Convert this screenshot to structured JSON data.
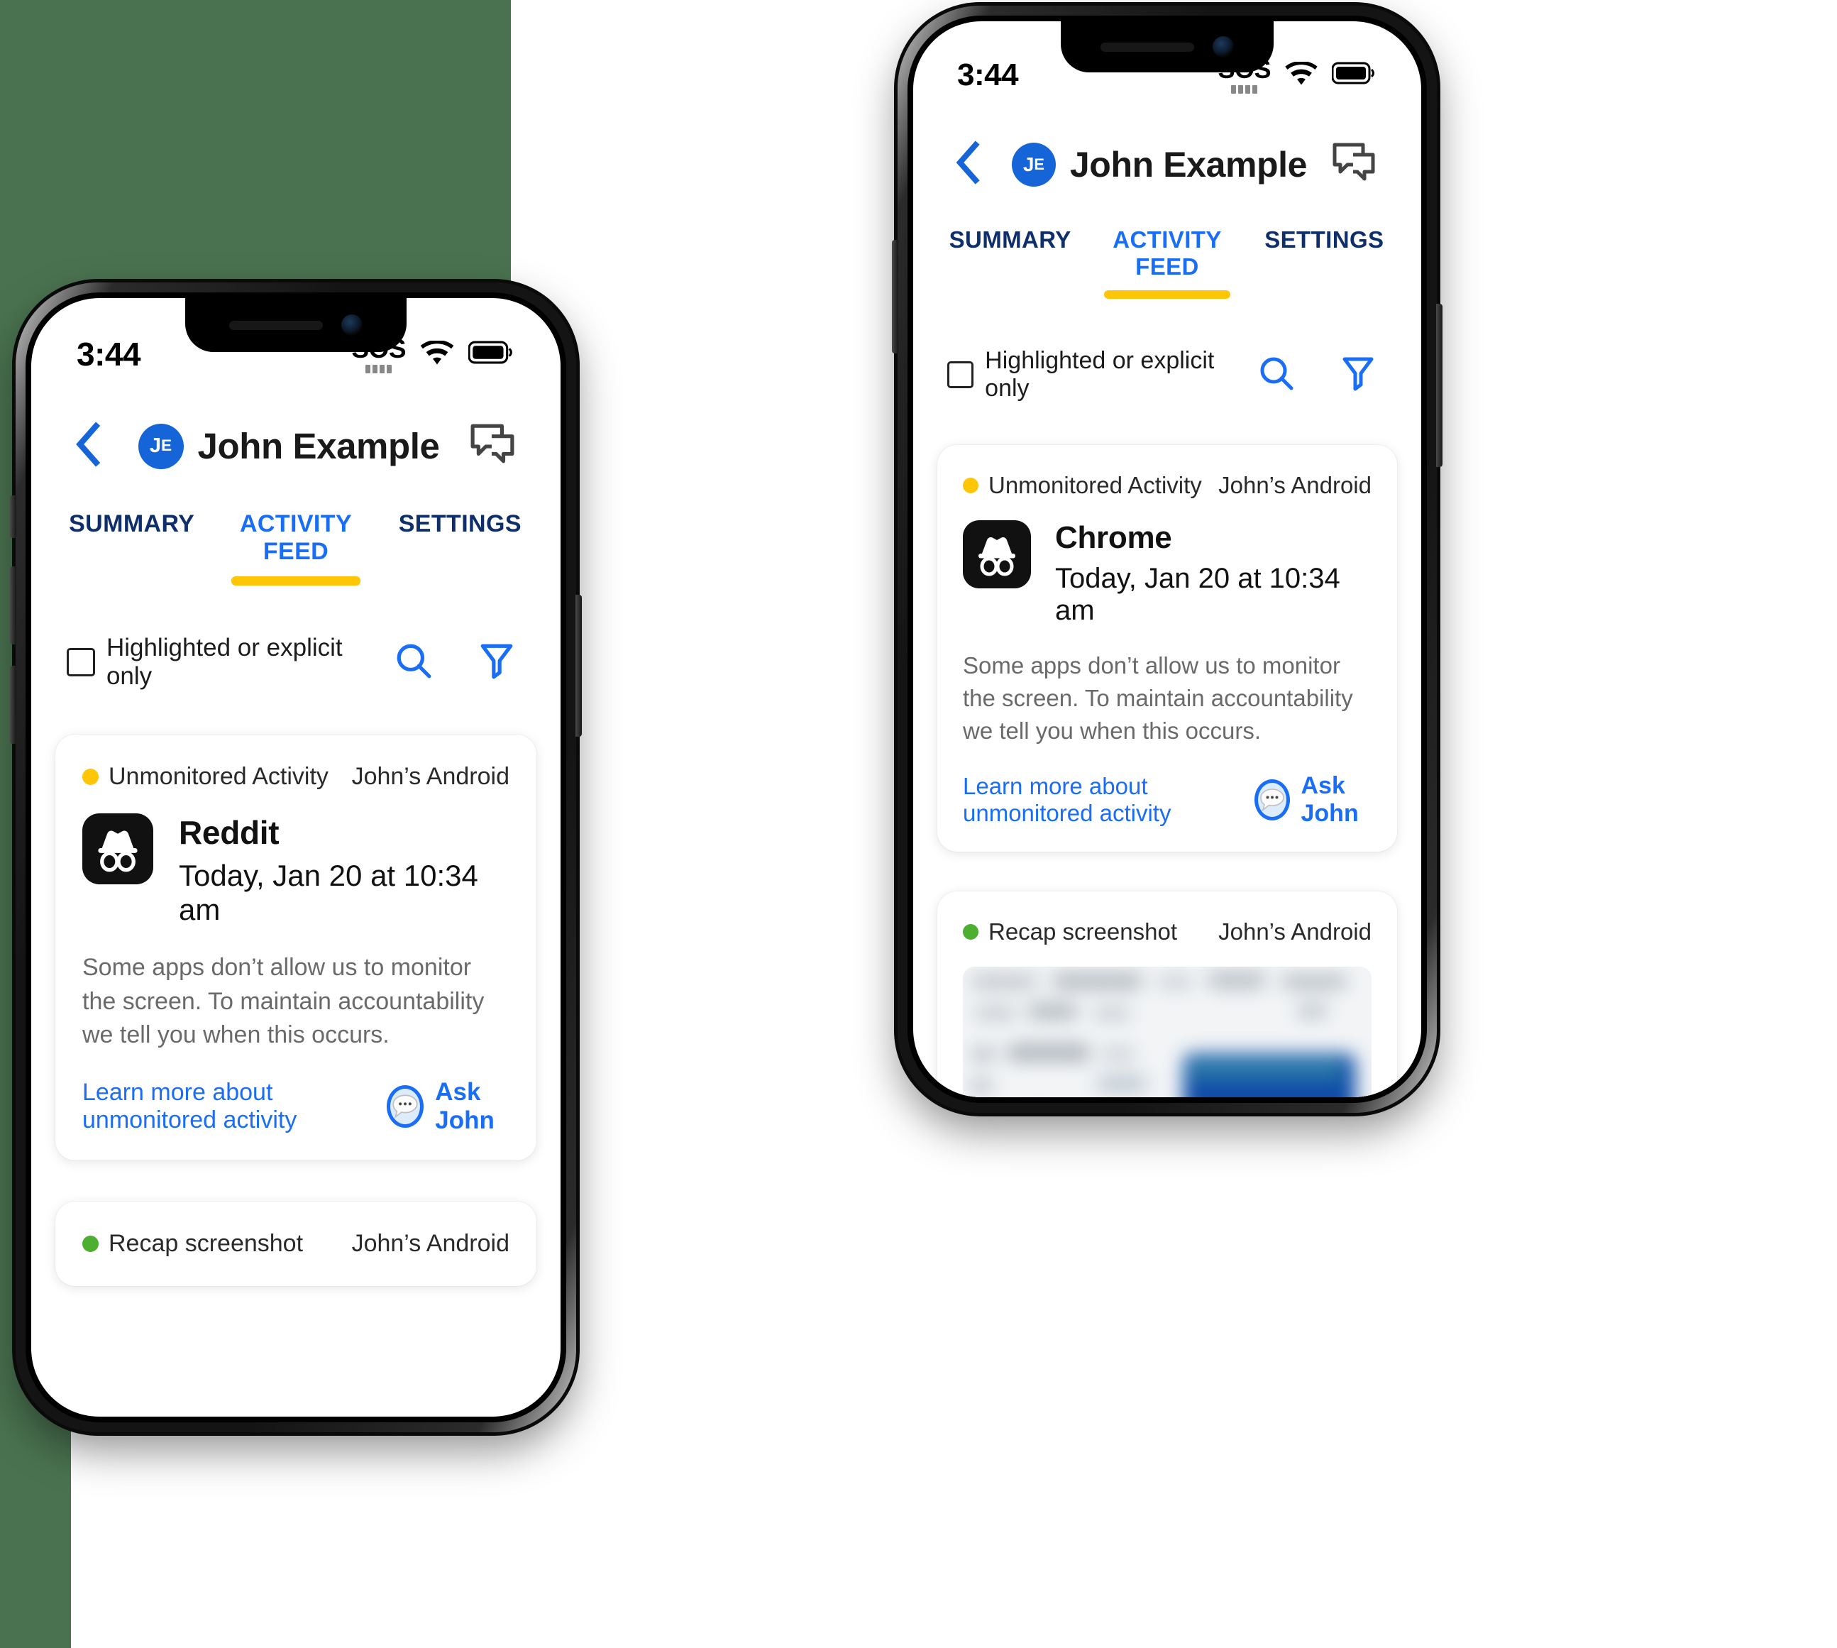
{
  "theme": {
    "background": "#4a7250",
    "accent_blue": "#1a6ef5",
    "tab_inactive": "#0f2f6b",
    "underline_yellow": "#ffc507",
    "status_yellow": "#ffc507",
    "status_green": "#4caf2f",
    "card_white": "#ffffff",
    "muted_text": "#6a6a6a"
  },
  "status_bar": {
    "time": "3:44",
    "sos_label": "SOS",
    "wifi_icon": "wifi-icon",
    "battery_icon": "battery-icon"
  },
  "nav": {
    "back_icon": "chevron-left-icon",
    "avatar_initials_first": "J",
    "avatar_initials_second": "E",
    "title": "John Example",
    "chat_icon": "chat-bubbles-icon"
  },
  "tabs": [
    {
      "label": "SUMMARY",
      "active": false
    },
    {
      "label": "ACTIVITY FEED",
      "active": true
    },
    {
      "label": "SETTINGS",
      "active": false
    }
  ],
  "filter_row": {
    "checkbox_checked": false,
    "checkbox_label": "Highlighted or explicit only",
    "search_icon": "search-icon",
    "filter_icon": "funnel-filter-icon"
  },
  "cards": {
    "front_phone": {
      "unmonitored": {
        "status_label": "Unmonitored Activity",
        "status_color": "#ffc507",
        "device": "John’s Android",
        "app_icon": "incognito-hat-glasses-icon",
        "app_name": "Reddit",
        "timestamp": "Today, Jan 20 at 10:34 am",
        "description": "Some apps don’t allow us to monitor the screen. To maintain accountability we tell you when this occurs.",
        "learn_more": "Learn more about unmonitored activity",
        "ask_button_label": "Ask John",
        "ask_button_icon": "chat-ellipsis-icon"
      },
      "recap": {
        "status_label": "Recap screenshot",
        "status_color": "#4caf2f",
        "device": "John’s Android"
      }
    },
    "back_phone": {
      "unmonitored": {
        "status_label": "Unmonitored Activity",
        "status_color": "#ffc507",
        "device": "John’s Android",
        "app_icon": "incognito-hat-glasses-icon",
        "app_name": "Chrome",
        "timestamp": "Today, Jan 20 at 10:34 am",
        "description": "Some apps don’t allow us to monitor the screen. To maintain accountability we tell you when this occurs.",
        "learn_more": "Learn more about unmonitored activity",
        "ask_button_label": "Ask John",
        "ask_button_icon": "chat-ellipsis-icon"
      },
      "recap": {
        "status_label": "Recap screenshot",
        "status_color": "#4caf2f",
        "device": "John’s Android",
        "screenshot_alt": "blurred-screenshot-thumbnail"
      }
    }
  }
}
